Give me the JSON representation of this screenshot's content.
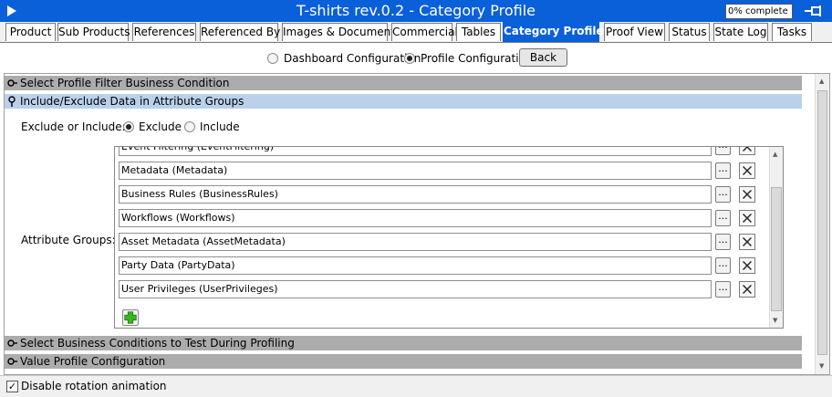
{
  "window": {
    "title": "T-shirts rev.0.2 - Category Profile",
    "progress_text": "0% complete"
  },
  "tabs": [
    {
      "label": "Product"
    },
    {
      "label": "Sub Products"
    },
    {
      "label": "References"
    },
    {
      "label": "Referenced By"
    },
    {
      "label": "Images & Documents"
    },
    {
      "label": "Commercial"
    },
    {
      "label": "Tables"
    },
    {
      "label": "Category Profile",
      "active": true
    },
    {
      "label": "Proof View"
    },
    {
      "label": "Status"
    },
    {
      "label": "State Log"
    },
    {
      "label": "Tasks"
    }
  ],
  "config": {
    "dashboard_label": "Dashboard Configuration",
    "profile_label": "Profile Configuration",
    "selected": "Profile Configuration",
    "back_label": "Back"
  },
  "sections": {
    "profile_filter": "Select Profile Filter Business Condition",
    "include_exclude": "Include/Exclude Data in Attribute Groups",
    "business_conditions": "Select Business Conditions to Test During Profiling",
    "value_profile": "Value Profile Configuration"
  },
  "include_exclude": {
    "label": "Exclude or Include:",
    "exclude_label": "Exclude",
    "include_label": "Include",
    "selected": "Exclude",
    "attribute_groups_label": "Attribute Groups:",
    "attribute_groups": [
      {
        "value": "Event Filtering (EventFiltering)"
      },
      {
        "value": "Metadata (Metadata)"
      },
      {
        "value": "Business Rules (BusinessRules)"
      },
      {
        "value": "Workflows (Workflows)"
      },
      {
        "value": "Asset Metadata (AssetMetadata)"
      },
      {
        "value": "Party Data (PartyData)"
      },
      {
        "value": "User Privileges (UserPrivileges)"
      }
    ],
    "browse_label": "..."
  },
  "footer": {
    "disable_rotation_label": "Disable rotation animation",
    "disable_rotation_checked": true
  },
  "colors": {
    "title_bar": "#0a60d8",
    "active_tab": "#0a60d8",
    "section_header": "#acacac",
    "open_section_header": "#b9d1ea"
  }
}
